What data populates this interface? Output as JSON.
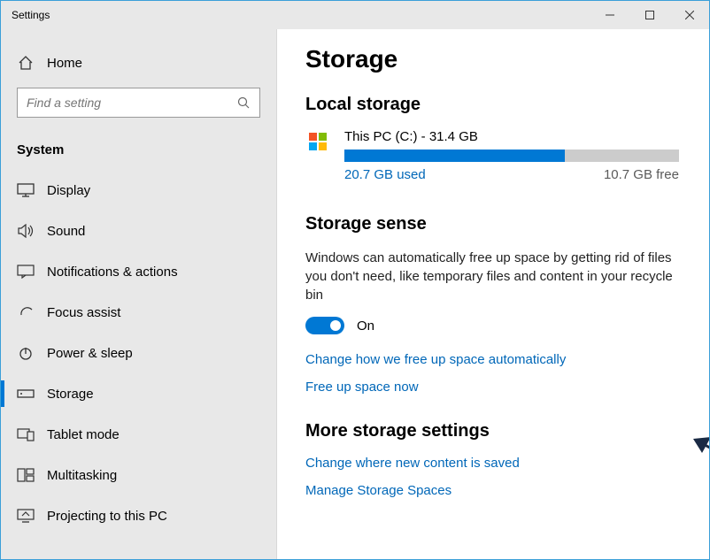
{
  "window": {
    "title": "Settings"
  },
  "sidebar": {
    "home": "Home",
    "search_placeholder": "Find a setting",
    "category": "System",
    "items": [
      {
        "label": "Display"
      },
      {
        "label": "Sound"
      },
      {
        "label": "Notifications & actions"
      },
      {
        "label": "Focus assist"
      },
      {
        "label": "Power & sleep"
      },
      {
        "label": "Storage"
      },
      {
        "label": "Tablet mode"
      },
      {
        "label": "Multitasking"
      },
      {
        "label": "Projecting to this PC"
      }
    ]
  },
  "main": {
    "title": "Storage",
    "local": {
      "heading": "Local storage",
      "drive_title": "This PC (C:) - 31.4 GB",
      "used": "20.7 GB used",
      "free": "10.7 GB free",
      "fill_pct": 65.9
    },
    "sense": {
      "heading": "Storage sense",
      "body": "Windows can automatically free up space by getting rid of files you don't need, like temporary files and content in your recycle bin",
      "toggle_state": "On",
      "link_auto": "Change how we free up space automatically",
      "link_free": "Free up space now"
    },
    "more": {
      "heading": "More storage settings",
      "link_where": "Change where new content is saved",
      "link_spaces": "Manage Storage Spaces"
    }
  }
}
